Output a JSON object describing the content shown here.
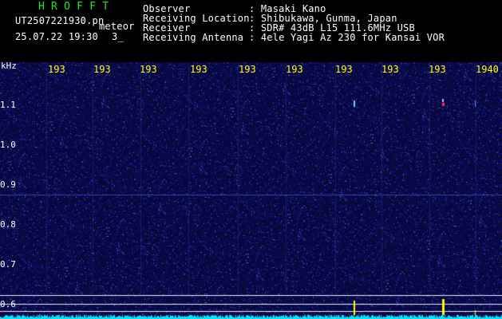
{
  "header": {
    "app_title": "H R O F F T",
    "filename": "UT2507221930.pn",
    "mode": "meteor",
    "datetime": "25.07.22 19:30",
    "counter": "3_",
    "fields": [
      {
        "label": "Observer",
        "value": ": Masaki Kano"
      },
      {
        "label": "Receiving Location",
        "value": ": Shibukawa, Gunma, Japan"
      },
      {
        "label": "Receiver",
        "value": ": SDR# 43dB L15 111.6MHz USB"
      },
      {
        "label": "Receiving Antenna",
        "value": ": 4ele Yagi Az 230 for Kansai VOR"
      }
    ]
  },
  "axis": {
    "unit": "kHz",
    "y_ticks": [
      "1.1",
      "1.0",
      "0.9",
      "0.8",
      "0.7",
      "0.6"
    ],
    "time_ticks": [
      "193",
      "193",
      "193",
      "193",
      "193",
      "193",
      "193",
      "193",
      "193",
      "1940"
    ]
  },
  "colors": {
    "background": "#000000",
    "noise_floor": "#101060",
    "header_title": "#22e622",
    "time_ticks": "#ffff00",
    "level_trace": "#00e5ff"
  }
}
